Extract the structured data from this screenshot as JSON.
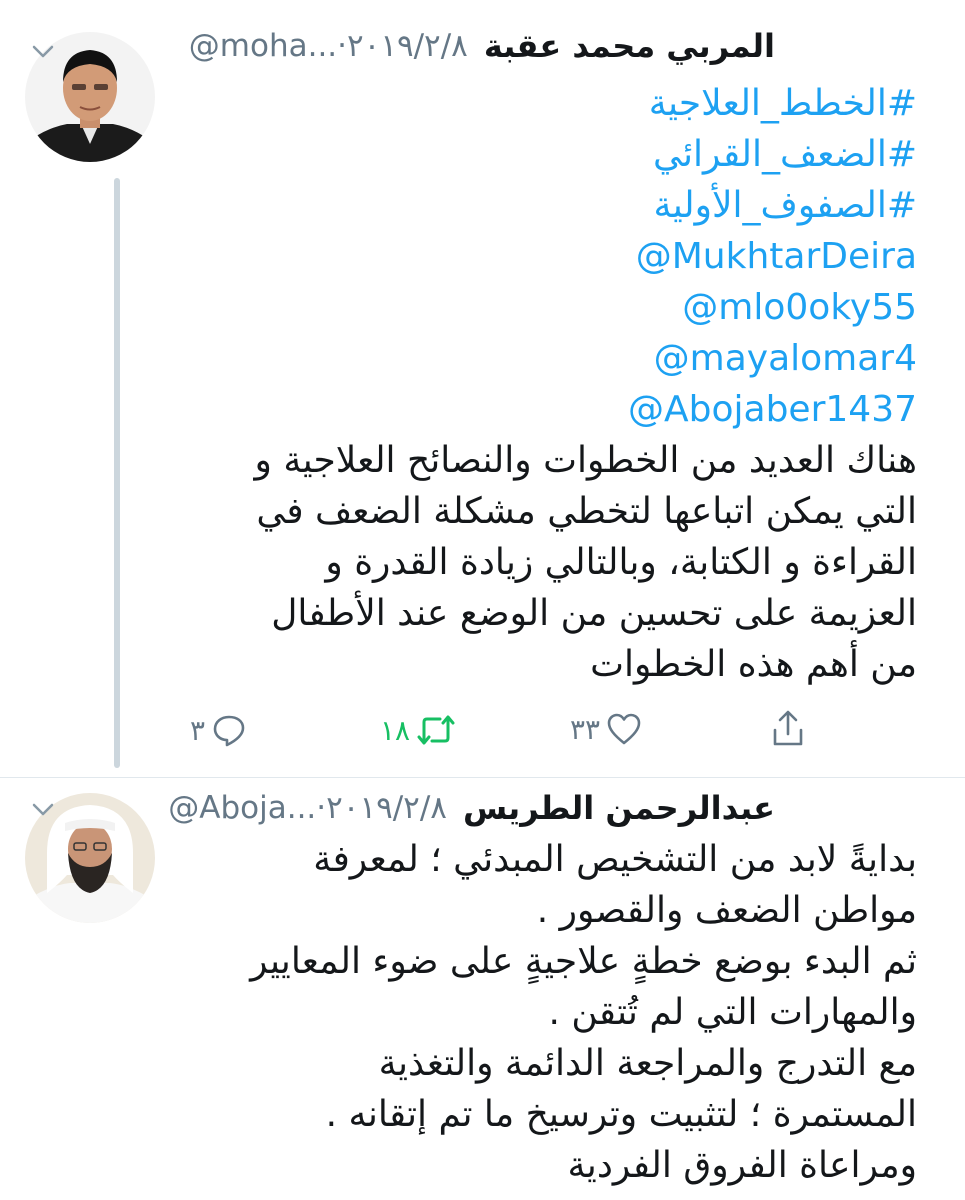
{
  "tweets": [
    {
      "name": "المربي محمد عقبة",
      "handle": "@moha...",
      "date": "٢٠١٩/٢/٨",
      "hashtags": [
        "#الخطط_العلاجية",
        "#الضعف_القرائي",
        "#الصفوف_الأولية"
      ],
      "mentions": [
        "@MukhtarDeira",
        "@mlo0oky55",
        "@mayalomar4",
        "@Abojaber1437"
      ],
      "text_lines": [
        "هناك العديد من الخطوات والنصائح العلاجية و",
        "التي يمكن اتباعها لتخطي مشكلة الضعف في",
        "القراءة و الكتابة، وبالتالي زيادة القدرة و",
        "العزيمة على تحسين من الوضع عند الأطفال",
        "من أهم هذه الخطوات"
      ],
      "counts": {
        "replies": "٣",
        "retweets": "١٨",
        "likes": "٣٣"
      }
    },
    {
      "name": "عبدالرحمن الطريس",
      "handle": "@Aboja...",
      "date": "٢٠١٩/٢/٨",
      "text_lines": [
        "بدايةً لابد من التشخيص المبدئي ؛ لمعرفة",
        "مواطن الضعف والقصور .",
        "ثم البدء بوضع خطةٍ علاجيةٍ على ضوء المعايير",
        "والمهارات التي لم تُتقن .",
        "مع التدرج والمراجعة الدائمة والتغذية",
        "المستمرة ؛ لتثبيت وترسيخ ما تم إتقانه .",
        "ومراعاة الفروق الفردية"
      ]
    }
  ],
  "icons": {
    "reply": "reply-icon",
    "retweet": "retweet-icon",
    "like": "heart-icon",
    "share": "share-icon",
    "menu": "chevron-down-icon"
  },
  "colors": {
    "link": "#1da1f2",
    "secondary_text": "#657786",
    "retweet_active": "#17bf63",
    "thread_line": "#ccd6dd"
  }
}
